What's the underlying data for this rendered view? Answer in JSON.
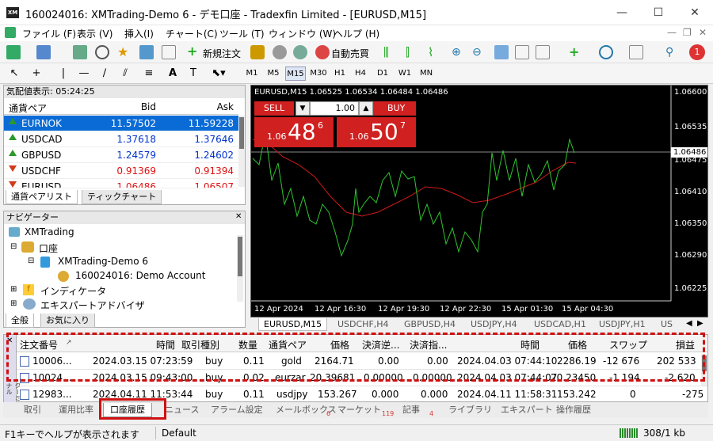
{
  "window": {
    "title": "160024016: XMTrading-Demo 6 - デモ口座 - Tradexfin Limited - [EURUSD,M15]"
  },
  "menu": [
    "ファイル (F)",
    "表示 (V)",
    "挿入(I)",
    "チャート(C)",
    "ツール (T)",
    "ウィンドウ (W)",
    "ヘルプ (H)"
  ],
  "toolbar": {
    "new_order": "新規注文",
    "auto_trade": "自動売買",
    "notif_count": "1"
  },
  "timeframes": [
    "M1",
    "M5",
    "M15",
    "M30",
    "H1",
    "H4",
    "D1",
    "W1",
    "MN"
  ],
  "timeframe_selected": "M15",
  "market_watch": {
    "title": "気配値表示: 05:24:25",
    "headers": {
      "symbol": "通貨ペア",
      "bid": "Bid",
      "ask": "Ask"
    },
    "rows": [
      {
        "symbol": "EURNOK",
        "bid": "11.57502",
        "ask": "11.59228",
        "dir": "up"
      },
      {
        "symbol": "USDCAD",
        "bid": "1.37618",
        "ask": "1.37646",
        "dir": "up"
      },
      {
        "symbol": "GBPUSD",
        "bid": "1.24579",
        "ask": "1.24602",
        "dir": "up"
      },
      {
        "symbol": "USDCHF",
        "bid": "0.91369",
        "ask": "0.91394",
        "dir": "down"
      },
      {
        "symbol": "EURUSD",
        "bid": "1.06486",
        "ask": "1.06507",
        "dir": "down"
      }
    ],
    "tabs": [
      "通貨ペアリスト",
      "ティックチャート"
    ]
  },
  "navigator": {
    "title": "ナビゲーター",
    "items": [
      "XMTrading",
      "口座",
      "XMTrading-Demo 6",
      "160024016: Demo Account",
      "インディケータ",
      "エキスパートアドバイザ"
    ],
    "tabs": [
      "全般",
      "お気に入り"
    ]
  },
  "chart": {
    "header": "EURUSD,M15  1.06525 1.06534 1.06484 1.06486",
    "sell_label": "SELL",
    "buy_label": "BUY",
    "lot": "1.00",
    "sell_price": {
      "prefix": "1.06",
      "big": "48",
      "sup": "6"
    },
    "buy_price": {
      "prefix": "1.06",
      "big": "50",
      "sup": "7"
    },
    "price_axis": [
      "1.06600",
      "1.06535",
      "1.06475",
      "1.06410",
      "1.06350",
      "1.06290",
      "1.06225"
    ],
    "current_price": "1.06486",
    "time_axis": [
      "12 Apr 2024",
      "12 Apr 16:30",
      "12 Apr 19:30",
      "12 Apr 22:30",
      "15 Apr 01:30",
      "15 Apr 04:30"
    ],
    "tabs": [
      "EURUSD,M15",
      "USDCHF,H4",
      "GBPUSD,H4",
      "USDJPY,H4",
      "USDCAD,H1",
      "USDJPY,H1",
      "US"
    ]
  },
  "terminal": {
    "headers": [
      "注文番号",
      "時間",
      "取引種別",
      "数量",
      "通貨ペア",
      "価格",
      "決済逆...",
      "決済指...",
      "時間",
      "価格",
      "スワップ",
      "損益"
    ],
    "rows": [
      [
        "10006...",
        "2024.03.15 07:23:59",
        "buy",
        "0.11",
        "gold",
        "2164.71",
        "0.00",
        "0.00",
        "2024.04.03 07:44:10",
        "2286.19",
        "-12 676",
        "202 533"
      ],
      [
        "10024...",
        "2024.03.15 09:43:00",
        "buy",
        "0.02",
        "eurzar",
        "20.39681",
        "0.00000",
        "0.00000",
        "2024.04.03 07:44:07",
        "20.23450",
        "-1 194",
        "-2 620"
      ],
      [
        "12983...",
        "2024.04.11 11:53:44",
        "buy",
        "0.11",
        "usdjpy",
        "153.267",
        "0.000",
        "0.000",
        "2024.04.11 11:58:31",
        "153.242",
        "0",
        "-275"
      ]
    ],
    "side_label": "ターミナル",
    "tabs": [
      "取引",
      "運用比率",
      "口座履歴",
      "ニュース",
      "アラーム設定",
      "メールボックス",
      "マーケット",
      "記事",
      "ライブラリ",
      "エキスパート",
      "操作履歴"
    ],
    "tab_badges": {
      "mail": "6",
      "market": "119",
      "articles": "4"
    }
  },
  "status": {
    "help": "F1キーでヘルプが表示されます",
    "profile": "Default",
    "traffic": "308/1 kb"
  }
}
